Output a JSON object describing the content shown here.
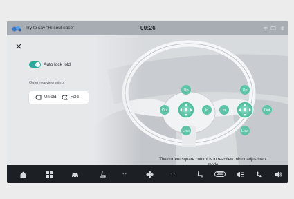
{
  "status": {
    "voice_hint": "Try to say \"Hi,soul ease\"",
    "time": "00:26"
  },
  "settings": {
    "auto_lock_fold_label": "Auto lock fold",
    "auto_lock_fold_on": true,
    "outer_mirror_label": "Outer rearview mirror",
    "unfold_label": "Unfold",
    "fold_label": "Fold",
    "accent_color": "#2aa89a"
  },
  "controls": {
    "left": {
      "up": "Up",
      "low": "Low",
      "out": "Out",
      "in": "In"
    },
    "right": {
      "up": "Up",
      "low": "Low",
      "out": "Out",
      "in": "In"
    },
    "color": "#5dc4a8"
  },
  "caption": "The current square control is in rearview mirror adjustment mode",
  "dock": {
    "temp_left": "- -",
    "temp_right": "- -",
    "badge_360": "360",
    "items": [
      "home-icon",
      "apps-grid-icon",
      "car-icon",
      "seat-icon",
      "fan-icon",
      "seat-heat-icon",
      "camera-360-icon",
      "headlight-icon",
      "phone-icon",
      "volume-icon"
    ]
  }
}
